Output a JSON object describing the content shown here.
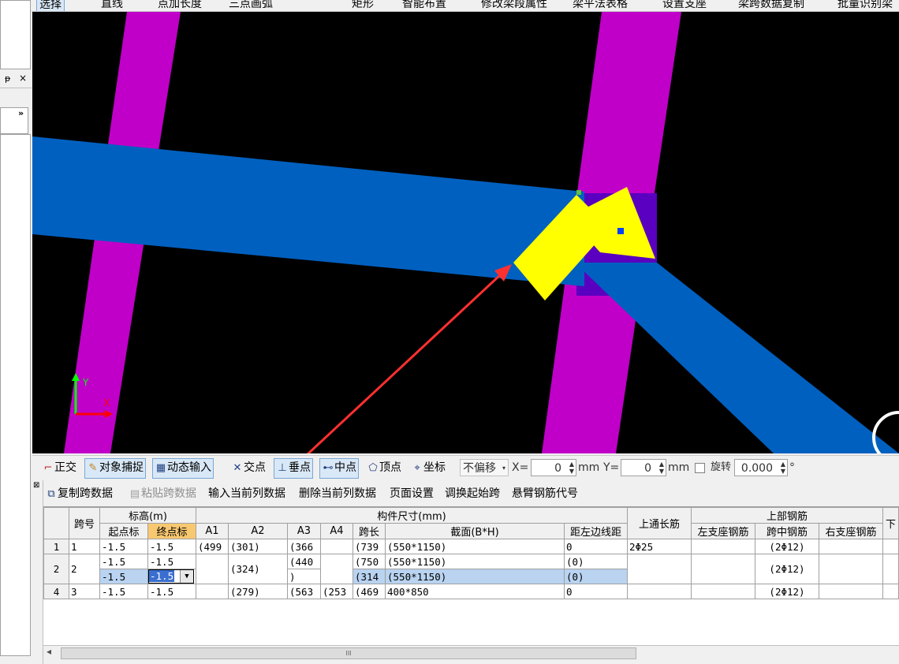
{
  "top_toolbar": {
    "items": [
      "选择",
      "直线",
      "点加长度",
      "三点画弧",
      "矩形",
      "智能布置",
      "修改梁段属性",
      "梁平法表格",
      "设置支座",
      "梁跨数据复制",
      "批量识别梁"
    ]
  },
  "left_panel": {
    "pin_label": "ᵽ",
    "close_label": "×",
    "expand_label": "»"
  },
  "canvas": {
    "background": "#000000",
    "column_color": "#c000c8",
    "beam_color": "#0060c0",
    "selection_color": "#ffff00",
    "axis_y_label": "Y",
    "axis_x_label": "X"
  },
  "snap_toolbar": {
    "ortho": "正交",
    "object_snap": "对象捕捉",
    "dynamic_input": "动态输入",
    "intersection": "交点",
    "perpendicular": "垂点",
    "midpoint": "中点",
    "vertex": "顶点",
    "coordinate": "坐标",
    "offset_select": "不偏移",
    "x_label": "X=",
    "x_value": "0",
    "x_unit": "mm",
    "y_label": "Y=",
    "y_value": "0",
    "y_unit": "mm",
    "rotate_label": "旋转",
    "rotate_value": "0.000",
    "degree_symbol": "°"
  },
  "grid_toolbar": {
    "copy_span": "复制跨数据",
    "paste_span": "粘贴跨数据",
    "input_column": "输入当前列数据",
    "delete_column": "删除当前列数据",
    "page_setup": "页面设置",
    "adjust_start": "调换起始跨",
    "cantilever_code": "悬臂钢筋代号"
  },
  "table": {
    "group_headers": {
      "span_no": "跨号",
      "elevation": "标高(m)",
      "dimensions": "构件尺寸(mm)",
      "top_through": "上通长筋",
      "top_rebar": "上部钢筋",
      "next": "下"
    },
    "sub_headers": {
      "start": "起点标",
      "end": "终点标",
      "a1": "A1",
      "a2": "A2",
      "a3": "A3",
      "a4": "A4",
      "span_len": "跨长",
      "section": "截面(B*H)",
      "edge_dist": "距左边线距",
      "left_support": "左支座钢筋",
      "mid_span": "跨中钢筋",
      "right_support": "右支座钢筋"
    },
    "rows": [
      {
        "row": "1",
        "span": "1",
        "start": "-1.5",
        "end": "-1.5",
        "a1": "(499",
        "a2": "(301)",
        "a3": "(366",
        "a4": "",
        "len": "(739",
        "section": "(550*1150)",
        "edge": "0",
        "through": "2Φ25",
        "left": "",
        "mid": "(2Φ12)",
        "right": ""
      },
      {
        "row": "2",
        "span": "2",
        "start": "-1.5",
        "end": "-1.5",
        "start2": "-1.5",
        "end2": "-1.5",
        "a1": "",
        "a2": "(324)",
        "a3": "(440",
        "a3b": ")",
        "a4": "",
        "len": "(750",
        "len2": "(314",
        "section": "(550*1150)",
        "section2": "(550*1150)",
        "edge": "(0)",
        "edge2": "(0)",
        "through": "",
        "left": "",
        "mid": "(2Φ12)",
        "right": ""
      },
      {
        "row": "4",
        "span": "3",
        "start": "-1.5",
        "end": "-1.5",
        "a1": "",
        "a2": "(279)",
        "a3": "(563",
        "a4": "(253",
        "len": "(469",
        "section": "400*850",
        "edge": "0",
        "through": "",
        "left": "",
        "mid": "(2Φ12)",
        "right": ""
      }
    ]
  },
  "scrollbar": {
    "left_arrow": "◂",
    "grip": "III"
  }
}
